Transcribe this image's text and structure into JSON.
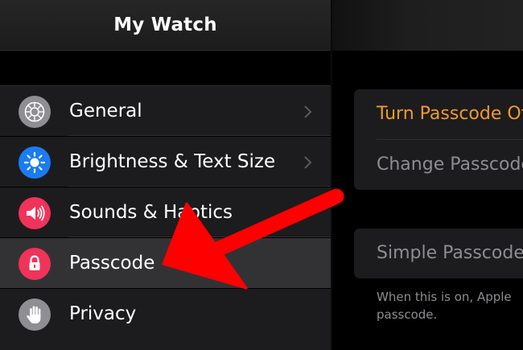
{
  "left_header": {
    "title": "My Watch"
  },
  "menu": [
    {
      "label": "General",
      "icon": "gear-icon",
      "color": "#8e8e93",
      "chevron": true
    },
    {
      "label": "Brightness & Text Size",
      "icon": "sun-icon",
      "color": "#1a7cf2",
      "chevron": true
    },
    {
      "label": "Sounds & Haptics",
      "icon": "speaker-icon",
      "color": "#f0335a",
      "chevron": false
    },
    {
      "label": "Passcode",
      "icon": "lock-icon",
      "color": "#f0335a",
      "chevron": false,
      "selected": true
    },
    {
      "label": "Privacy",
      "icon": "hand-icon",
      "color": "#8e8e93",
      "chevron": false
    }
  ],
  "detail": {
    "turn_passcode_off": "Turn Passcode Off",
    "change_passcode": "Change Passcode",
    "simple_passcode": "Simple Passcode",
    "footer_line1": "When this is on, Apple",
    "footer_line2": "passcode."
  },
  "annotation": {
    "arrow_color": "#ff0000"
  }
}
